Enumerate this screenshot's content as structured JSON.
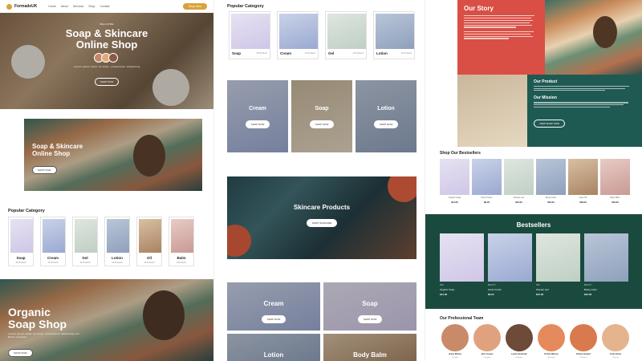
{
  "nav": {
    "brand": "FormadeUK",
    "links": [
      "Home",
      "About",
      "Services",
      "Shop",
      "Contact"
    ],
    "shop_button": "Shop Now"
  },
  "hero": {
    "eyebrow": "WELCOME",
    "title_line1": "Soap & Skincare",
    "title_line2": "Online Shop",
    "body": "Lorem ipsum dolor sit amet, consectetur adipiscing",
    "button": "SHOP NOW"
  },
  "banner2": {
    "title_line1": "Soap & Skincare",
    "title_line2": "Online Shop",
    "button": "SHOP NOW"
  },
  "popular_left": {
    "title": "Popular Category",
    "items": [
      {
        "label": "Soap",
        "sub": "48 Products"
      },
      {
        "label": "Cream",
        "sub": "12 Products"
      },
      {
        "label": "Gel",
        "sub": "10 Products"
      },
      {
        "label": "Lotion",
        "sub": "12 Products"
      },
      {
        "label": "Oil",
        "sub": "15 Products"
      },
      {
        "label": "Balm",
        "sub": "8 Products"
      }
    ]
  },
  "organic": {
    "title_line1": "Organic",
    "title_line2": "Soap Shop",
    "body": "Lorem ipsum dolor sit amet, consectetur adipiscing elit. Nulla molestie",
    "button": "SHOP NOW"
  },
  "popular_top": {
    "title": "Popular Category",
    "items": [
      {
        "label": "Soap",
        "sub": "48 Products"
      },
      {
        "label": "Cream",
        "sub": "12 Products"
      },
      {
        "label": "Gel",
        "sub": "10 Products"
      },
      {
        "label": "Lotion",
        "sub": "12 Products"
      }
    ]
  },
  "category_tiles": [
    {
      "label": "Cream",
      "button": "SHOP NOW"
    },
    {
      "label": "Soap",
      "button": "SHOP NOW"
    },
    {
      "label": "Lotion",
      "button": "SHOP NOW"
    }
  ],
  "skincare_banner": {
    "title": "Skincare Products",
    "button": "SHOP SKINCARE"
  },
  "bottom_tiles": [
    {
      "label": "Cream",
      "button": "SHOP NOW"
    },
    {
      "label": "Soap",
      "button": "SHOP NOW"
    },
    {
      "label": "Lotion"
    },
    {
      "label": "Body Balm"
    }
  ],
  "story": {
    "title": "Our Story",
    "product_title": "Our Product",
    "mission_title": "Our Mission",
    "button": "VIEW SHOP NOW"
  },
  "bestsellers_small": {
    "title": "Shop Our Bestsellers",
    "items": [
      {
        "name": "Organic Soap",
        "price": "$14.00"
      },
      {
        "name": "Hand Cream",
        "price": "$9.00"
      },
      {
        "name": "Shower Gel",
        "price": "$12.00"
      },
      {
        "name": "Body Lotion",
        "price": "$16.00"
      },
      {
        "name": "Face Oil",
        "price": "$18.00"
      },
      {
        "name": "Body Balm",
        "price": "$15.00"
      }
    ]
  },
  "bestsellers_big": {
    "title": "Bestsellers",
    "items": [
      {
        "cat": "SPA",
        "name": "Organic Soap",
        "price": "$14.00"
      },
      {
        "cat": "BEAUTY",
        "name": "Hand Cream",
        "price": "$9.00"
      },
      {
        "cat": "SPA",
        "name": "Shower Gel",
        "price": "$12.00"
      },
      {
        "cat": "BEAUTY",
        "name": "Body Lotion",
        "price": "$16.00"
      }
    ]
  },
  "team": {
    "title": "Our Professional Team",
    "members": [
      {
        "name": "Jenny Wilson",
        "role": "Founder"
      },
      {
        "name": "Jane Cooper",
        "role": "Designer"
      },
      {
        "name": "Leslie Alexander",
        "role": "Manager"
      },
      {
        "name": "Kristin Watson",
        "role": "Specialist"
      },
      {
        "name": "Esther Howard",
        "role": "Therapist"
      },
      {
        "name": "Cody Fisher",
        "role": "Chemist"
      }
    ]
  }
}
